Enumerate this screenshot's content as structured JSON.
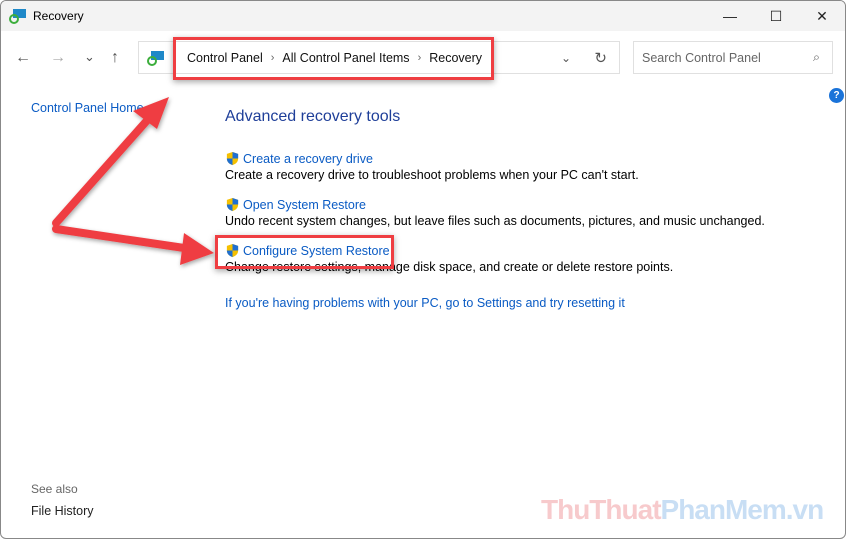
{
  "window": {
    "title": "Recovery",
    "minimize": "—",
    "maximize": "☐",
    "close": "✕"
  },
  "nav": {
    "back": "←",
    "forward": "→",
    "recent": "⌄",
    "up": "↑",
    "dropdown": "⌄",
    "refresh": "↻"
  },
  "breadcrumb": [
    "Control Panel",
    "All Control Panel Items",
    "Recovery"
  ],
  "search": {
    "placeholder": "Search Control Panel"
  },
  "sidebar": {
    "home": "Control Panel Home",
    "see_also": "See also",
    "file_history": "File History"
  },
  "main": {
    "heading": "Advanced recovery tools",
    "items": [
      {
        "label": "Create a recovery drive",
        "desc": "Create a recovery drive to troubleshoot problems when your PC can't start."
      },
      {
        "label": "Open System Restore",
        "desc": "Undo recent system changes, but leave files such as documents, pictures, and music unchanged."
      },
      {
        "label": "Configure System Restore",
        "desc": "Change restore settings, manage disk space, and create or delete restore points."
      }
    ],
    "reset_link": "If you're having problems with your PC, go to Settings and try resetting it"
  },
  "watermark": {
    "part1": "ThuThuat",
    "part2": "PhanMem",
    "part3": ".vn"
  },
  "colors": {
    "link": "#0a5bc4",
    "annotation": "#ef3e42"
  }
}
